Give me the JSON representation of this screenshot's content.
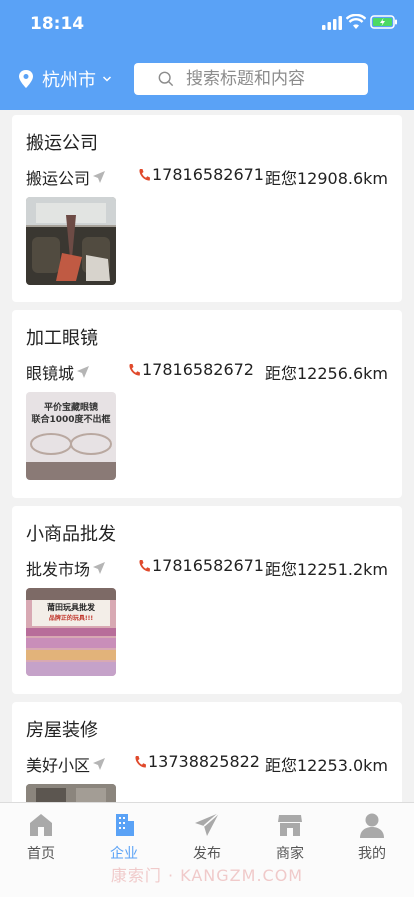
{
  "status_bar": {
    "time": "18:14"
  },
  "header": {
    "city": "杭州市",
    "search_placeholder": "搜索标题和内容"
  },
  "listings": [
    {
      "title": "搬运公司",
      "name": "搬运公司",
      "phone": "17816582671",
      "distance": "距您12908.6km"
    },
    {
      "title": "加工眼镜",
      "name": "眼镜城",
      "phone": "17816582672",
      "distance": "距您12256.6km",
      "thumb_text": [
        "平价宝藏眼镜",
        "联合1000度不出框"
      ]
    },
    {
      "title": "小商品批发",
      "name": "批发市场",
      "phone": "17816582671",
      "distance": "距您12251.2km",
      "thumb_text": [
        "莆田玩具批发",
        "品牌正的玩具!!!"
      ]
    },
    {
      "title": "房屋装修",
      "name": "美好小区",
      "phone": "13738825822",
      "distance": "距您12253.0km"
    }
  ],
  "tabbar": {
    "items": [
      {
        "label": "首页",
        "icon": "home-icon"
      },
      {
        "label": "企业",
        "icon": "building-icon"
      },
      {
        "label": "发布",
        "icon": "paper-plane-icon"
      },
      {
        "label": "商家",
        "icon": "shop-icon"
      },
      {
        "label": "我的",
        "icon": "user-icon"
      }
    ],
    "active": "企业"
  },
  "watermark": "康索门 · KANGZM.COM",
  "colors": {
    "accent": "#5aa2f6",
    "phone": "#e04a2c"
  }
}
